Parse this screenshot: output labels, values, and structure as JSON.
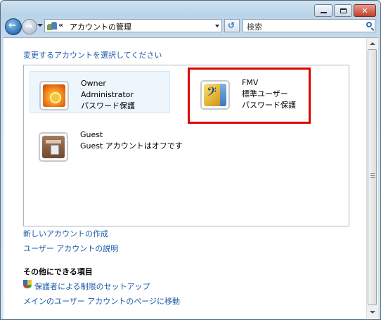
{
  "window": {
    "caption_buttons": {
      "minimize": "minimize",
      "maximize": "maximize",
      "close": "✕"
    }
  },
  "navbar": {
    "back_icon": "back-arrow-icon",
    "forward_icon": "forward-arrow-icon",
    "address_chevron": "«",
    "address_text": "アカウントの管理",
    "refresh_icon": "refresh-icon",
    "search_placeholder": "検索"
  },
  "main": {
    "heading": "変更するアカウントを選択してください",
    "accounts": [
      {
        "lines": [
          "Owner",
          "Administrator",
          "パスワード保護"
        ],
        "picture": "flower",
        "selected": true
      },
      {
        "lines": [
          "FMV",
          "標準ユーザー",
          "パスワード保護"
        ],
        "picture": "bass-clef",
        "highlighted": true
      },
      {
        "lines": [
          "Guest",
          "Guest アカウントはオフです"
        ],
        "picture": "briefcase"
      }
    ],
    "links": {
      "create_account": "新しいアカウントの作成",
      "about_accounts": "ユーザー アカウントの説明"
    },
    "other_section_title": "その他にできる項目",
    "other_links": {
      "parental_controls": "保護者による制限のセットアップ",
      "main_user_accounts": "メインのユーザー アカウントのページに移動"
    }
  },
  "colors": {
    "link": "#1a59a8",
    "highlight_border": "#e00000",
    "selected_bg": "#eef6fd"
  }
}
